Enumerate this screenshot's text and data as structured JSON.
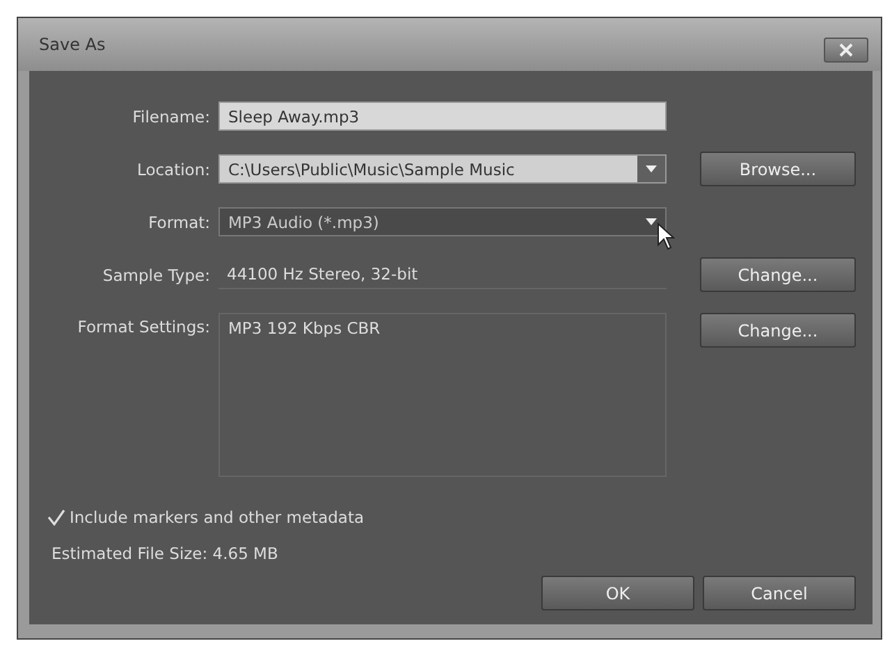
{
  "window": {
    "title": "Save As"
  },
  "fields": [
    {
      "kind": "text",
      "label": "Filename:",
      "value": "Sleep Away.mp3"
    },
    {
      "kind": "dropdown",
      "label": "Location:",
      "value": "C:\\Users\\Public\\Music\\Sample Music",
      "button": "Browse..."
    },
    {
      "kind": "select",
      "label": "Format:",
      "value": "MP3 Audio (*.mp3)"
    },
    {
      "kind": "info",
      "label": "Sample Type:",
      "value": "44100 Hz Stereo, 32-bit",
      "button": "Change..."
    },
    {
      "kind": "panel",
      "label": "Format Settings:",
      "value": "MP3 192 Kbps CBR",
      "button": "Change..."
    }
  ],
  "checkbox": {
    "label": "Include markers and other metadata",
    "checked": true
  },
  "estimate": "Estimated File Size: 4.65 MB",
  "buttons": [
    "OK",
    "Cancel"
  ]
}
